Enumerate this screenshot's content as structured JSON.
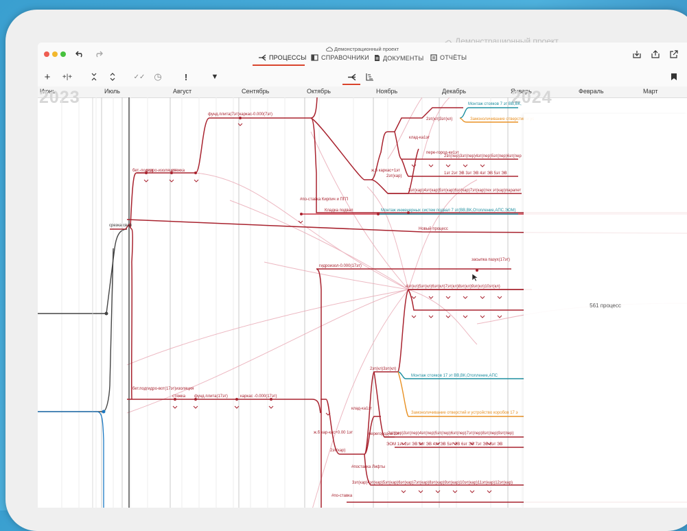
{
  "window": {
    "project_title": "Демонстрационный проект",
    "ghost_title": "Демонстрационный проект",
    "colors": {
      "accent": "#d9442c",
      "red": "#a8222e",
      "teal": "#1e8fa0",
      "orange": "#e89124",
      "pink": "#e8a6b2",
      "dark": "#333333"
    }
  },
  "nav": {
    "tabs": [
      {
        "label": "ПРОЦЕССЫ",
        "icon": "process-icon",
        "active": true
      },
      {
        "label": "СПРАВОЧНИКИ",
        "icon": "book-icon",
        "active": false
      },
      {
        "label": "ДОКУМЕНТЫ",
        "icon": "document-icon",
        "active": false
      },
      {
        "label": "ОТЧЁТЫ",
        "icon": "report-icon",
        "active": false
      }
    ]
  },
  "toolbar": {
    "icons": [
      "add-icon",
      "split-icon",
      "collapse-icon",
      "expand-icon",
      "double-check-icon",
      "history-icon",
      "warning-icon",
      "filter-icon",
      "process-view-icon",
      "gantt-view-icon",
      "bookmark-icon"
    ],
    "labels": {
      "add": "+",
      "split": "+|+",
      "collapse": "⇣",
      "expand": "⇡",
      "check": "✓✓",
      "history": "◷",
      "warning": "!",
      "filter": "▼"
    }
  },
  "timeline": {
    "years": [
      "2023",
      "2024"
    ],
    "months": [
      "Июнь",
      "Июль",
      "Август",
      "Сентябрь",
      "Октябрь",
      "Ноябрь",
      "Декабрь",
      "Январь",
      "Февраль",
      "Март"
    ]
  },
  "gantt": {
    "labels": {
      "fund": "фунд.плита(7эт)каркас-0.000(7эт)",
      "bet": "бет.-подгот.",
      "gidro": "гидро-изоляция",
      "styazhka": "стяжка",
      "srezka": "срезка свай",
      "montazh_top": "Монтаж стояков 7 эт ВВ,ВК,",
      "zamonol_top": "Замоноличивание отверстий и ус",
      "kladka_1": "клад-ка1эт",
      "zhb": "ж.б каркас+1эт",
      "et2kar": "2эт(кар)",
      "pere": "пере-город-ки1эт",
      "row_2et": "2эт(кл)3эт(кл)",
      "row_pereg": "2эт(пер)3эт(пер)4эт(пер)5эт(пер)6эт(пер",
      "row_sh": "1эт  2эт ЭВ  3эт ЭВ  4эт ЭВ  5эт ЭВ",
      "row_kar": "3эт(кар)4эт(кар)5эт(кар)6эт(кар)7эт(кар)тех эт(кар)парапет",
      "postavka": "#по-ставка Кирпич и ПГП",
      "kladka_podval": "Кладка подвал",
      "montazh_ing": "Монтаж инженерных систем подвал 7 эт(ВВ,ВК,Отопление,АПС,ЭОМ)",
      "novy": "Новый процесс",
      "gidroizol": "гидроизол-0.000(17эт)",
      "zasypka": "засыпка пазух(17эт)",
      "row_kl17": "4эт(кл)5эт(кл)6эт(кл)7эт(кл)8эт(кл)9эт(кл)10эт(кл)",
      "row_2kl": "2эт(кл)3эт(кл)",
      "montazh_17": "Монтаж стояков 17 эт ВВ,ВК,Отопление,АПС",
      "zamonol_17": "Замоноличивание отверстий и устройство коробов 17 э",
      "bet17": "бет.подгидро-вот(17эт)изоляция",
      "styazhka17": "стяжка",
      "fund17": "фунд.плита(17эт)",
      "karkas17": "каркас -0.000(17эт)",
      "kladka_17": "клад-ка1эт",
      "zhb17": "ж.б кар-кас+0.00 1эт",
      "et2kar17": "2эт(кар)",
      "peregorod17": "перегород ки1эт",
      "row_pereg17": "2эт(пер)3эт(пер)4эт(пер)5эт(пер)6эт(пер)7эт(пер)8эт(пер)9эт(пер)",
      "row_eom": "ЭОМ 1эт  2эт ЭВ  3эт ЭВ  4эт ЭВ  5эт ЭВ  6эт ЭВ  7эт ЭВ  8эт ЭВ",
      "postavka_lift": "#поставка Лифты",
      "row_kar17": "3эт(кар)4эт(кар)5эт(кар)6эт(кар)7эт(кар)8эт(кар)9эт(кар)10эт(кар)11эт(кар)12эт(кар)",
      "postavka2": "#по-ставка"
    }
  },
  "panel": {
    "count_label": "561 процесс"
  }
}
